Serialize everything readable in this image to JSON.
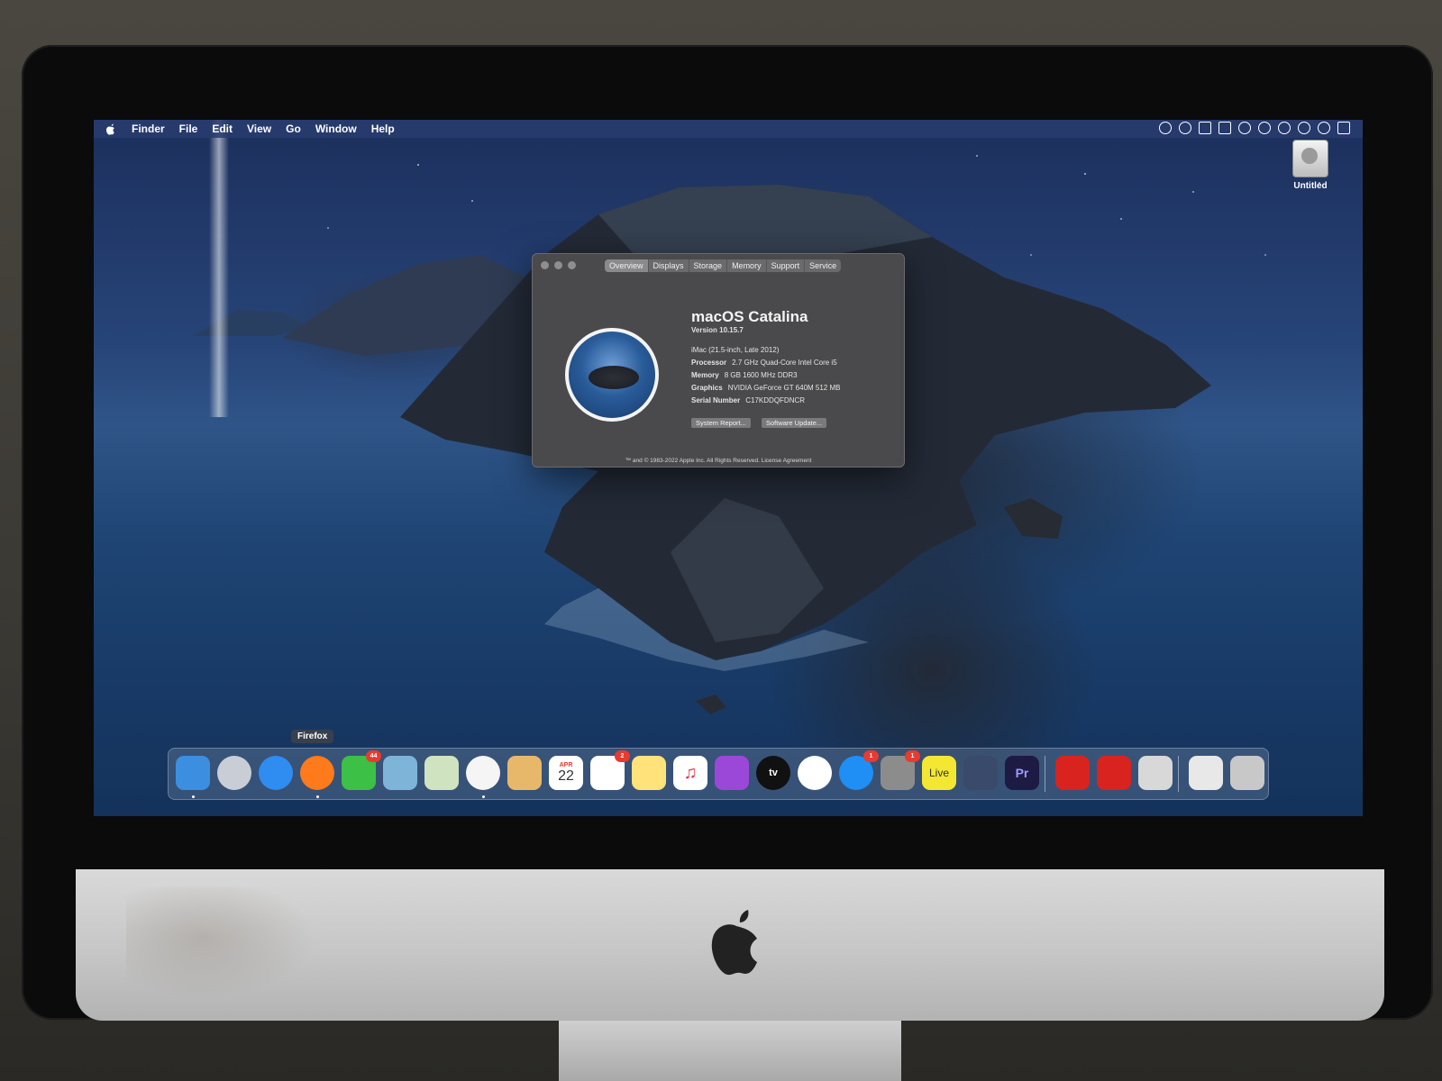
{
  "menubar": {
    "app": "Finder",
    "items": [
      "File",
      "Edit",
      "View",
      "Go",
      "Window",
      "Help"
    ]
  },
  "desktop": {
    "drive_label": "Untitled"
  },
  "about_window": {
    "tabs": [
      "Overview",
      "Displays",
      "Storage",
      "Memory",
      "Support",
      "Service"
    ],
    "active_tab": "Overview",
    "os_name": "macOS Catalina",
    "version": "Version 10.15.7",
    "model": "iMac (21.5-inch, Late 2012)",
    "specs": [
      {
        "label": "Processor",
        "value": "2.7 GHz Quad-Core Intel Core i5"
      },
      {
        "label": "Memory",
        "value": "8 GB 1600 MHz DDR3"
      },
      {
        "label": "Graphics",
        "value": "NVIDIA GeForce GT 640M 512 MB"
      },
      {
        "label": "Serial Number",
        "value": "C17KDDQFDNCR"
      }
    ],
    "buttons": {
      "system_report": "System Report...",
      "software_update": "Software Update..."
    },
    "footer": "™ and © 1983-2022 Apple Inc. All Rights Reserved. License Agreement"
  },
  "dock": {
    "tooltip": "Firefox",
    "calendar_month": "APR",
    "calendar_day": "22",
    "facetime_badge": "44",
    "reminders_badge": "2",
    "appstore_badge": "1",
    "prefs_badge": "1",
    "appletv_label": "tv",
    "live_label": "Live",
    "premiere_label": "Pr",
    "colors": {
      "finder": "#3b8ee0",
      "launchpad": "#c9ced6",
      "safari": "#2f8cf0",
      "firefox": "#ff7a1a",
      "facetime": "#3cc046",
      "preview": "#7fb4d9",
      "maps": "#cfe3c1",
      "photos": "#f5f5f5",
      "contacts": "#e8b86a",
      "calendar": "#ffffff",
      "reminders": "#ffffff",
      "notes": "#ffe27a",
      "music": "#ffffff",
      "podcasts": "#9b48d8",
      "appletv": "#111111",
      "news": "#ffffff",
      "appstore": "#1f8ff5",
      "prefs": "#8c8c8c",
      "live": "#f3e733",
      "davinci": "#3a4a6a",
      "premiere": "#1d1a44",
      "acrobat": "#d9231f",
      "acrobat2": "#d9231f",
      "screensaver": "#d8d8d8",
      "documents": "#e8e8e8",
      "trash": "#c8c8c8"
    }
  }
}
